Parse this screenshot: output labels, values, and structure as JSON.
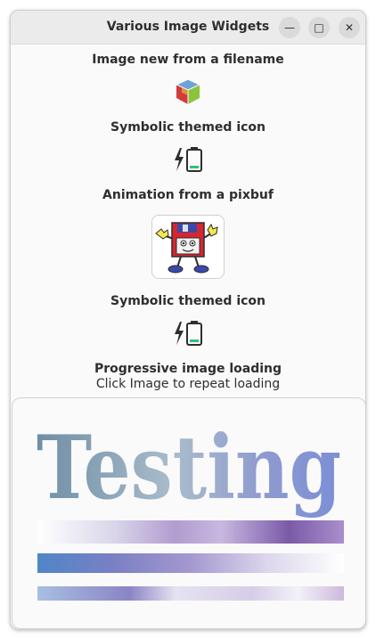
{
  "window": {
    "title": "Various Image Widgets",
    "minimize_symbol": "—",
    "maximize_symbol": "□",
    "close_symbol": "✕"
  },
  "sections": [
    {
      "heading": "Image new from a filename",
      "icon": "gtk-logo-cube-icon"
    },
    {
      "heading": "Symbolic themed icon",
      "icon": "battery-charging-symbolic-icon"
    },
    {
      "heading": "Animation from a pixbuf",
      "icon": "floppy-man-animation"
    },
    {
      "heading": "Symbolic themed icon",
      "icon": "battery-charging-symbolic-icon"
    }
  ],
  "progressive": {
    "heading": "Progressive image loading",
    "hint": "Click Image to repeat loading",
    "image_text": "Testing"
  },
  "colors": {
    "battery_level": "#2ec27e",
    "accent_purple": "#7a5aa8",
    "accent_blue": "#4f86c6"
  }
}
